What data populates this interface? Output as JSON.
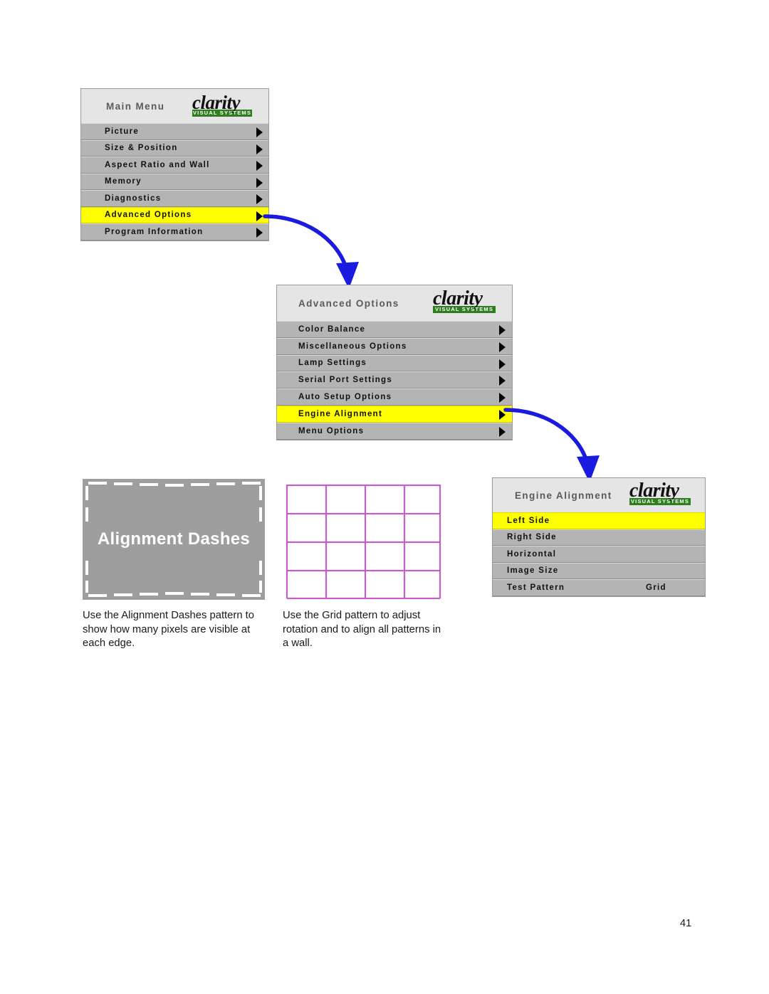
{
  "page": {
    "number": "41"
  },
  "logo": {
    "word": "clarity",
    "tagline": "VISUAL SYSTEMS"
  },
  "menus": {
    "main": {
      "title": "Main Menu",
      "items": [
        {
          "label": "Picture",
          "has_arrow": true,
          "selected": false
        },
        {
          "label": "Size & Position",
          "has_arrow": true,
          "selected": false
        },
        {
          "label": "Aspect Ratio and Wall",
          "has_arrow": true,
          "selected": false
        },
        {
          "label": "Memory",
          "has_arrow": true,
          "selected": false
        },
        {
          "label": "Diagnostics",
          "has_arrow": true,
          "selected": false
        },
        {
          "label": "Advanced Options",
          "has_arrow": true,
          "selected": true
        },
        {
          "label": "Program Information",
          "has_arrow": true,
          "selected": false
        }
      ]
    },
    "advanced": {
      "title": "Advanced Options",
      "items": [
        {
          "label": "Color Balance",
          "has_arrow": true,
          "selected": false
        },
        {
          "label": "Miscellaneous Options",
          "has_arrow": true,
          "selected": false
        },
        {
          "label": "Lamp Settings",
          "has_arrow": true,
          "selected": false
        },
        {
          "label": "Serial Port Settings",
          "has_arrow": true,
          "selected": false
        },
        {
          "label": "Auto Setup Options",
          "has_arrow": true,
          "selected": false
        },
        {
          "label": "Engine Alignment",
          "has_arrow": true,
          "selected": true
        },
        {
          "label": "Menu Options",
          "has_arrow": true,
          "selected": false
        }
      ]
    },
    "engine": {
      "title": "Engine Alignment",
      "items": [
        {
          "label": "Left Side",
          "value": "",
          "selected": true
        },
        {
          "label": "Right Side",
          "value": "",
          "selected": false
        },
        {
          "label": "Horizontal",
          "value": "",
          "selected": false
        },
        {
          "label": "Image Size",
          "value": "",
          "selected": false
        },
        {
          "label": "Test Pattern",
          "value": "Grid",
          "selected": false
        }
      ]
    }
  },
  "patterns": {
    "dashes": {
      "caption_text": "Alignment Dashes",
      "background_color": "#9e9e9e",
      "dash_color": "#ffffff"
    },
    "grid": {
      "line_color": "#c060c8",
      "columns": 4,
      "rows": 4
    }
  },
  "captions": {
    "left": "Use the Alignment Dashes pattern to show how many pixels are visible at each edge.",
    "right": "Use the Grid pattern to adjust rotation and to align all patterns in a wall."
  },
  "colors": {
    "highlight": "#ffff00",
    "row_background": "#b4b4b4",
    "header_background": "#e5e5e5",
    "arrow_blue": "#1a1ae0",
    "logo_green": "#2e7d1e"
  }
}
